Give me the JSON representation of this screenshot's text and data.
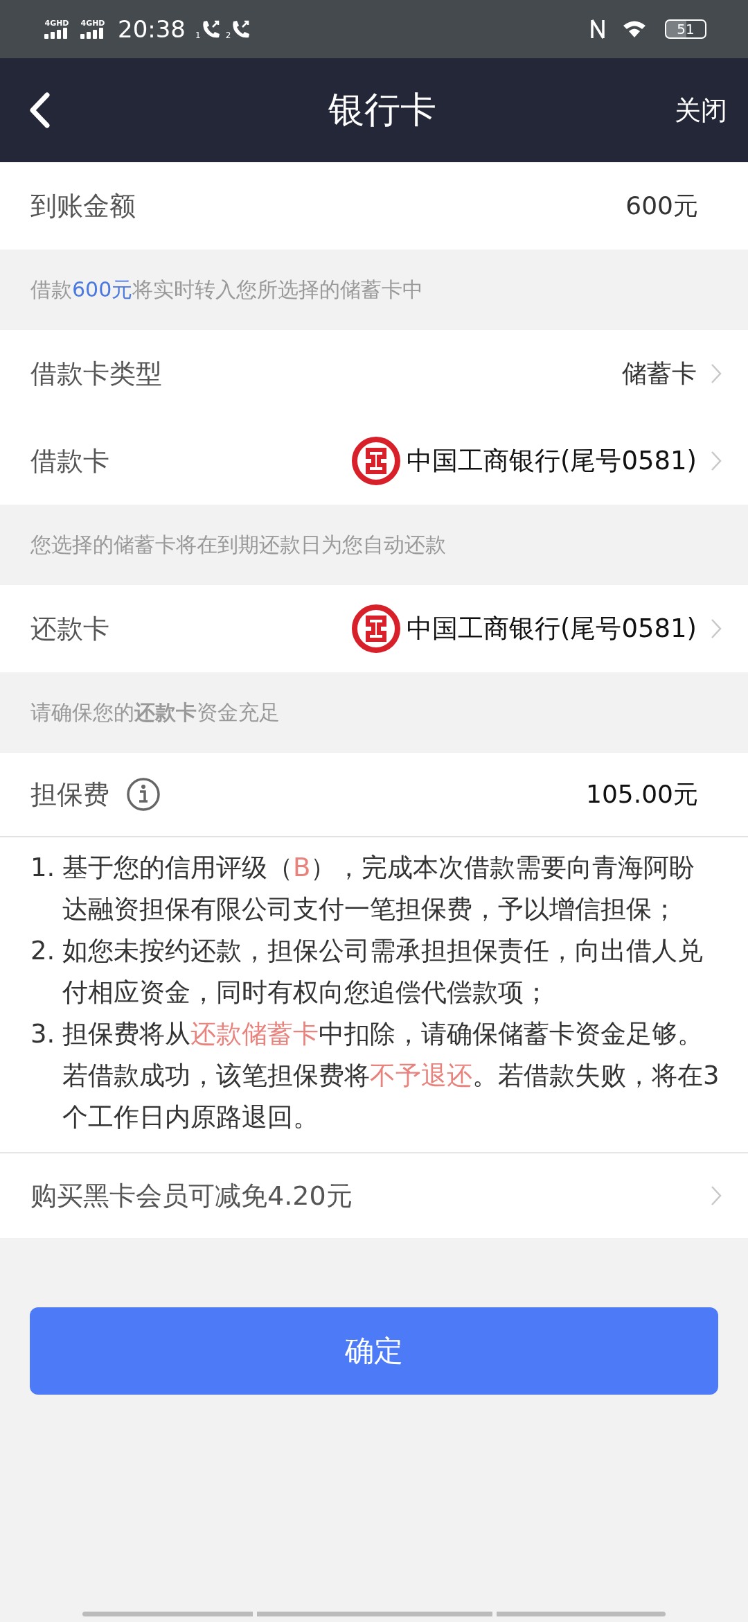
{
  "status_bar": {
    "signals": [
      "4GHD",
      "4GHD"
    ],
    "time": "20:38",
    "calls": [
      "1",
      "2"
    ],
    "battery": "51"
  },
  "nav": {
    "title": "银行卡",
    "close": "关闭"
  },
  "arrival": {
    "label": "到账金额",
    "value": "600元"
  },
  "hint_transfer": [
    {
      "text": "借款",
      "kind": "plain"
    },
    {
      "text": "600元",
      "kind": "amount"
    },
    {
      "text": "将实时转入您所选择的储蓄卡中",
      "kind": "plain"
    }
  ],
  "loan_rows": [
    {
      "label": "借款卡类型",
      "value": "储蓄卡",
      "bank_logo": false
    },
    {
      "label": "借款卡",
      "value": "中国工商银行(尾号0581)",
      "bank_logo": true
    }
  ],
  "hint_auto": "您选择的储蓄卡将在到期还款日为您自动还款",
  "repay_row": {
    "label": "还款卡",
    "value": "中国工商银行(尾号0581)",
    "bank_logo": true
  },
  "hint_funds": "请确保您的**还款卡**资金充足",
  "fee": {
    "label": "担保费",
    "value": "105.00元"
  },
  "notes": [
    {
      "number": "1.",
      "parts": [
        {
          "text": "基于您的信用评级（",
          "kind": "plain"
        },
        {
          "text": "B",
          "kind": "alert"
        },
        {
          "text": "），完成本次借款需要向青海阿盼达融资担保有限公司支付一笔担保费，予以增信担保；",
          "kind": "plain"
        }
      ]
    },
    {
      "number": "2.",
      "parts": [
        {
          "text": "如您未按约还款，担保公司需承担担保责任，向出借人兑付相应资金，同时有权向您追偿代偿款项；",
          "kind": "plain"
        }
      ]
    },
    {
      "number": "3.",
      "parts": [
        {
          "text": "担保费将从",
          "kind": "plain"
        },
        {
          "text": "还款储蓄卡",
          "kind": "alert"
        },
        {
          "text": "中扣除，请确保储蓄卡资金足够。若借款成功，该笔担保费将",
          "kind": "plain"
        },
        {
          "text": "不予退还",
          "kind": "alert"
        },
        {
          "text": "。若借款失败，将在3个工作日内原路退回。",
          "kind": "plain"
        }
      ]
    }
  ],
  "membership": {
    "label": "购买黑卡会员可减免4.20元"
  },
  "confirm": "确定"
}
